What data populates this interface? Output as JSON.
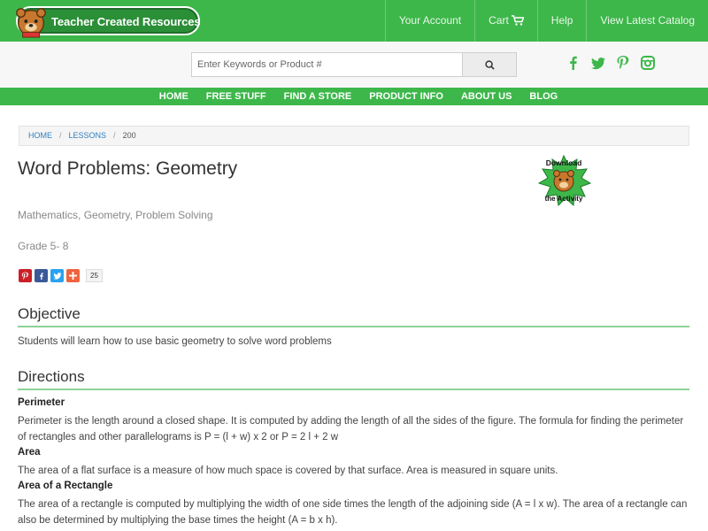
{
  "header": {
    "logo_text": "Teacher Created Resources",
    "nav": [
      {
        "label": "Your Account"
      },
      {
        "label": "Cart"
      },
      {
        "label": "Help"
      },
      {
        "label": "View Latest Catalog"
      }
    ]
  },
  "search": {
    "placeholder": "Enter Keywords or Product #"
  },
  "social": [
    "facebook-icon",
    "twitter-icon",
    "pinterest-icon",
    "instagram-icon"
  ],
  "main_nav": [
    "HOME",
    "FREE STUFF",
    "FIND A STORE",
    "PRODUCT INFO",
    "ABOUT US",
    "BLOG"
  ],
  "breadcrumb": {
    "home": "HOME",
    "lessons": "LESSONS",
    "current": "200",
    "separator": "/"
  },
  "page": {
    "title": "Word Problems: Geometry",
    "download_line1": "Download",
    "download_line2": "the Activity",
    "subjects": "Mathematics, Geometry, Problem Solving",
    "grade": "Grade 5- 8",
    "share_count": "25",
    "objective_heading": "Objective",
    "objective_text": "Students will learn how to use basic geometry to solve word problems",
    "directions_heading": "Directions",
    "perimeter_heading": "Perimeter",
    "perimeter_text": "Perimeter is the length around a closed shape. It is computed by adding the length of all the sides of the figure. The formula for finding the perimeter of rectangles and other parallelograms is P = (l + w) x 2 or P = 2 l + 2 w",
    "area_heading": "Area",
    "area_text": "The area of a flat surface is a measure of how much space is covered by that surface. Area is measured in square units.",
    "area_rect_heading": "Area of a Rectangle",
    "area_rect_text": "The area of a rectangle is computed by multiplying the width of one side times the length of the adjoining side (A = l x w). The area of a rectangle can also be determined by multiplying the base times the height (A = b x h)."
  },
  "colors": {
    "brand_green": "#3db74a",
    "link_blue": "#2f7fbf"
  }
}
